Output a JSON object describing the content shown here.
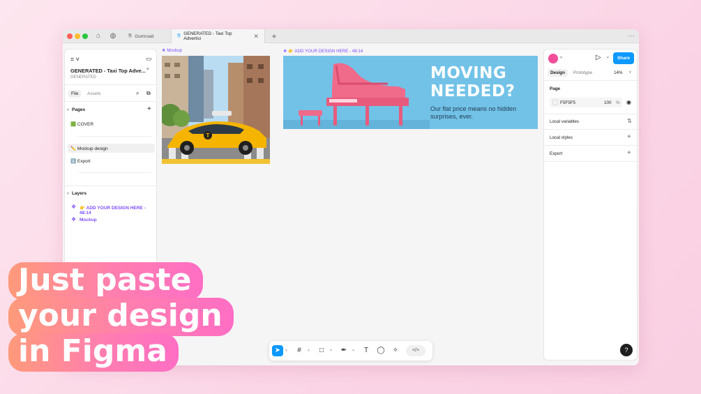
{
  "browser": {
    "tabs": [
      {
        "label": "Gumroad"
      },
      {
        "label": "GENERATED - Taxi Top Advertisi"
      }
    ],
    "new_tab": "+",
    "more": "···"
  },
  "left_panel": {
    "file_title": "GENERATED - Taxi Top Adve...",
    "file_subtitle": "GENERATED",
    "tabs": [
      "File",
      "Assets"
    ],
    "pages_heading": "Pages",
    "pages": [
      "🟩 COVER",
      "✏️ Mockup design",
      "⬇️ Export"
    ],
    "layers_heading": "Layers",
    "layers": [
      "👉 ADD YOUR DESIGN HERE - 48:14",
      "Mockup"
    ]
  },
  "canvas": {
    "mockup_label": "Mockup",
    "banner_label": "👉 ADD YOUR DESIGN HERE - 48:14",
    "banner_heading_1": "MOVING",
    "banner_heading_2": "NEEDED?",
    "banner_body_1": "Our flat price means no hidden",
    "banner_body_2": "surprises, ever.",
    "taxi_letter": "T"
  },
  "right_panel": {
    "share": "Share",
    "tabs": [
      "Design",
      "Prototype"
    ],
    "zoom": "14%",
    "page_heading": "Page",
    "page_color": "F5F5F5",
    "page_opacity": "100",
    "percent": "%",
    "sections": [
      "Local variables",
      "Local styles",
      "Export"
    ]
  },
  "toolbar": {
    "help": "?"
  },
  "overlay": {
    "line1": "Just paste",
    "line2": "your design",
    "line3": "in Figma"
  },
  "colors": {
    "accent": "#0d99ff",
    "layer_purple": "#7c4dff",
    "banner_bg": "#72c2e8",
    "piano_pink": "#f06a8a"
  }
}
